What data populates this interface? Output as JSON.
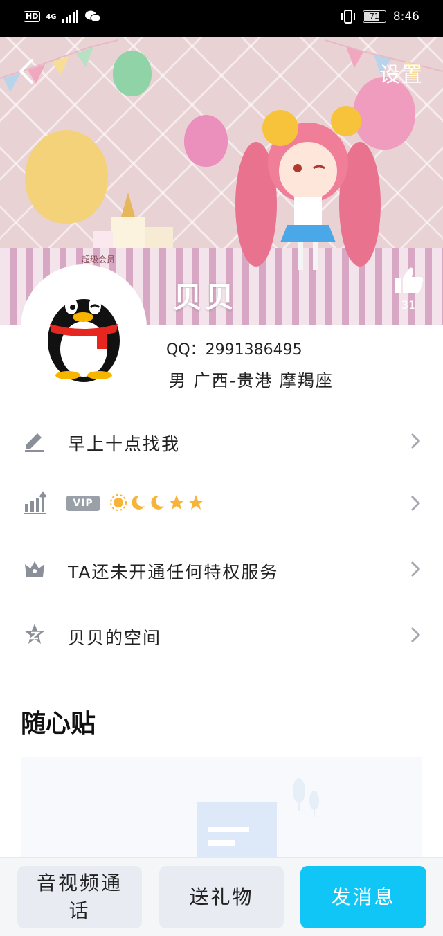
{
  "status_bar": {
    "left_indicators": [
      "HD",
      "4G"
    ],
    "battery": "71",
    "time": "8:46"
  },
  "header": {
    "settings_label": "设置",
    "badge_label": "超级会员",
    "nickname": "贝贝",
    "like_count": "31"
  },
  "profile": {
    "qq_line": "QQ：2991386495",
    "meta_line": "男  广西-贵港  摩羯座"
  },
  "list": {
    "signature": "早上十点找我",
    "vip_badge": "VIP",
    "privilege": "TA还未开通任何特权服务",
    "space": "贝贝的空间"
  },
  "section": {
    "title": "随心贴"
  },
  "actions": {
    "call": "音视频通话",
    "gift": "送礼物",
    "message": "发消息"
  },
  "colors": {
    "primary_button": "#10c6f6",
    "secondary_button": "#e8ebf2",
    "icon_gray": "#8a8f99"
  }
}
